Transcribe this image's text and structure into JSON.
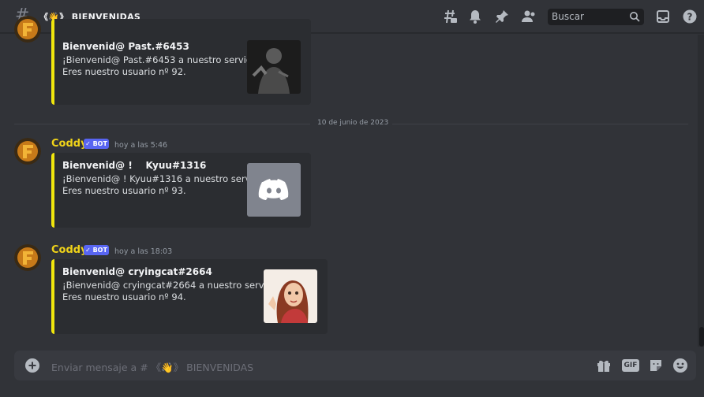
{
  "header": {
    "channel_name": "《👋》 BIENVENIDAS",
    "search_placeholder": "Buscar"
  },
  "divider": {
    "date": "10 de junio de 2023"
  },
  "messages": [
    {
      "embed": {
        "title": "Bienvenid@ Past.#6453",
        "line1": "¡Bienvenid@ Past.#6453 a nuestro servidor!",
        "line2": "Eres nuestro usuario nº 92."
      }
    },
    {
      "username": "Coddy",
      "badge": "✓ BOT",
      "timestamp": "hoy a las 5:46",
      "embed": {
        "title": "Bienvenid@ !    Kyuu#1316",
        "line1": "¡Bienvenid@ ! Kyuu#1316 a nuestro servidor!",
        "line2": "Eres nuestro usuario nº 93."
      }
    },
    {
      "username": "Coddy",
      "badge": "✓ BOT",
      "timestamp": "hoy a las 18:03",
      "embed": {
        "title": "Bienvenid@ cryingcat#2664",
        "line1": "¡Bienvenid@ cryingcat#2664 a nuestro servidor!",
        "line2": "Eres nuestro usuario nº 94."
      }
    }
  ],
  "composer": {
    "placeholder": "Enviar mensaje a # 《👋》 BIENVENIDAS",
    "gif_label": "GIF"
  },
  "colors": {
    "username": "#f0d319",
    "embed_border": "#f0e60d",
    "bot_badge": "#5865f2"
  }
}
